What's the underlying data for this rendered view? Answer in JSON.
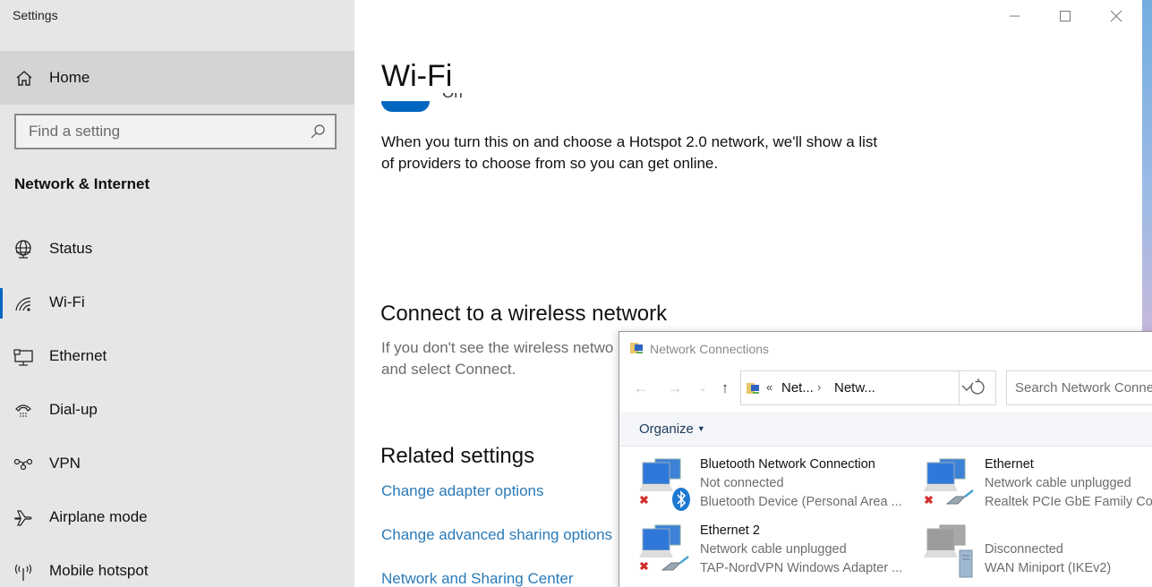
{
  "window": {
    "app_title": "Settings",
    "controls": {
      "minimize": "minimize",
      "maximize": "maximize",
      "close": "close"
    }
  },
  "sidebar": {
    "home_label": "Home",
    "search_placeholder": "Find a setting",
    "section_title": "Network & Internet",
    "items": [
      {
        "label": "Status",
        "icon": "globe-icon",
        "active": false
      },
      {
        "label": "Wi-Fi",
        "icon": "wifi-icon",
        "active": true
      },
      {
        "label": "Ethernet",
        "icon": "ethernet-icon",
        "active": false
      },
      {
        "label": "Dial-up",
        "icon": "dialup-phone-icon",
        "active": false
      },
      {
        "label": "VPN",
        "icon": "vpn-icon",
        "active": false
      },
      {
        "label": "Airplane mode",
        "icon": "airplane-icon",
        "active": false
      },
      {
        "label": "Mobile hotspot",
        "icon": "hotspot-icon",
        "active": false
      }
    ]
  },
  "main": {
    "title": "Wi-Fi",
    "hotspot_toggle": {
      "state": "On",
      "label": "On"
    },
    "hotspot_description": "When you turn this on and choose a Hotspot 2.0 network, we'll show a list of providers to choose from so you can get online.",
    "connect_heading": "Connect to a wireless network",
    "connect_text": "If you don't see the wireless network you want, select it and select Connect.",
    "connect_text_visible_line1": "If you don't see the wireless netwo",
    "connect_text_visible_line2": "and select Connect.",
    "related_heading": "Related settings",
    "related_links": [
      "Change adapter options",
      "Change advanced sharing options",
      "Network and Sharing Center"
    ]
  },
  "network_connections": {
    "title": "Network Connections",
    "breadcrumb": [
      "Net...",
      "Netw..."
    ],
    "breadcrumb_prefix": "«",
    "search_placeholder": "Search Network Connections",
    "organize_label": "Organize",
    "connections": [
      {
        "name": "Bluetooth Network Connection",
        "status": "Not connected",
        "device": "Bluetooth Device (Personal Area ...",
        "badge": "bluetooth",
        "error": true
      },
      {
        "name": "Ethernet",
        "status": "Network cable unplugged",
        "device": "Realtek PCIe GbE Family Controller",
        "badge": "cable",
        "error": true
      },
      {
        "name": "Ethernet 2",
        "status": "Network cable unplugged",
        "device": "TAP-NordVPN Windows Adapter ...",
        "badge": "cable",
        "error": true
      },
      {
        "name": "",
        "status": "Disconnected",
        "device": "WAN Miniport (IKEv2)",
        "badge": "server",
        "error": false
      }
    ]
  },
  "colors": {
    "accent": "#0067c0",
    "link": "#2a7ab8",
    "sidebar_bg": "#e6e6e6",
    "home_bg": "#d4d4d4",
    "error_red": "#d0302a"
  }
}
